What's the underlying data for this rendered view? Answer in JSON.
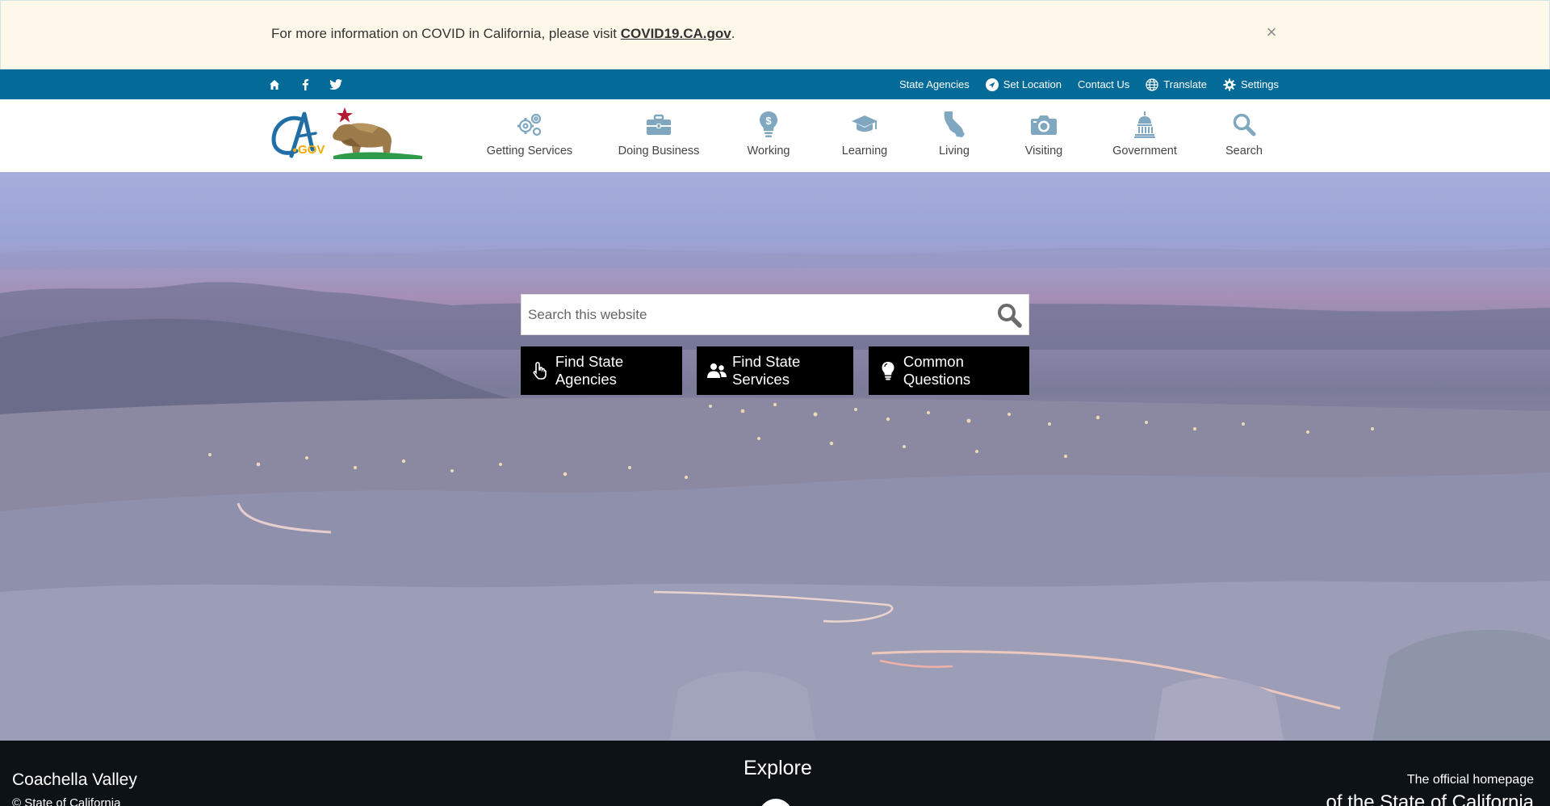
{
  "alert": {
    "text": "For more information on COVID in California, please visit ",
    "link_text": "COVID19.CA.gov",
    "suffix": ".",
    "close_label": "×"
  },
  "utility": {
    "social": [
      {
        "icon": "home-icon"
      },
      {
        "icon": "facebook-icon"
      },
      {
        "icon": "twitter-icon"
      }
    ],
    "links": {
      "state_agencies": "State Agencies",
      "set_location": "Set Location",
      "contact_us": "Contact Us",
      "translate": "Translate",
      "settings": "Settings"
    }
  },
  "nav": {
    "getting_services": "Getting Services",
    "doing_business": "Doing Business",
    "working": "Working",
    "learning": "Learning",
    "living": "Living",
    "visiting": "Visiting",
    "government": "Government",
    "search": "Search"
  },
  "hero": {
    "search_placeholder": "Search this website",
    "buttons": {
      "find_agencies": "Find State Agencies",
      "find_services": "Find State Services",
      "common_questions": "Common Questions"
    }
  },
  "footer": {
    "location": "Coachella Valley",
    "copyright": "© State of California",
    "explore": "Explore",
    "tagline_1": "The official homepage",
    "tagline_2": "of the State of California"
  },
  "colors": {
    "utility_bar": "#046b99",
    "nav_icon": "#7fa8c0",
    "alert_bg": "#fef8ea",
    "footer_bg": "#0c1216"
  }
}
